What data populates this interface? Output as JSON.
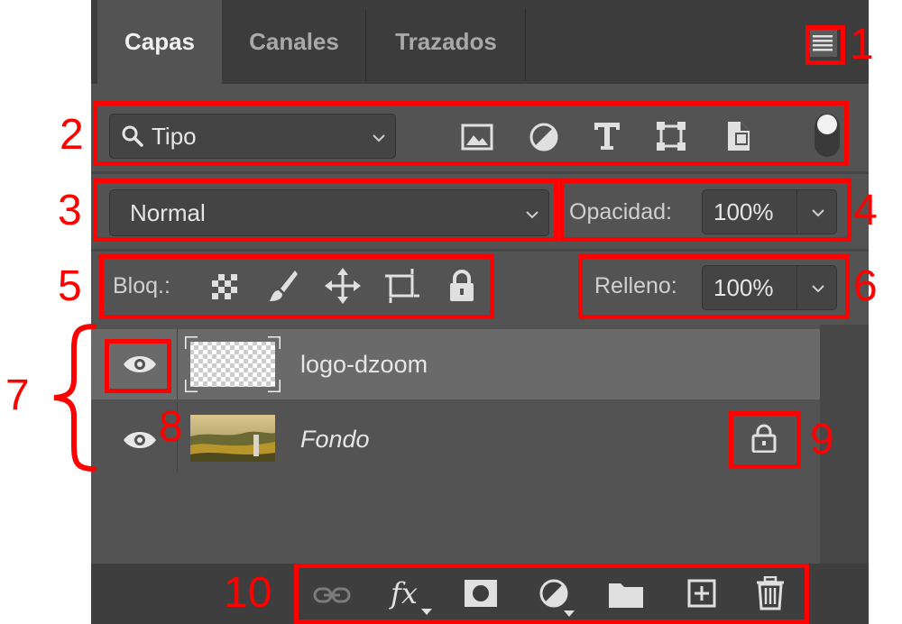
{
  "panel": {
    "tabs": [
      {
        "label": "Capas",
        "active": true
      },
      {
        "label": "Canales",
        "active": false
      },
      {
        "label": "Trazados",
        "active": false
      }
    ],
    "menu_icon": "panel-menu-icon"
  },
  "filter": {
    "search_label": "Tipo",
    "icons": [
      "image-filter-icon",
      "adjustment-filter-icon",
      "type-filter-icon",
      "shape-filter-icon",
      "smart-object-filter-icon",
      "filter-toggle-icon"
    ]
  },
  "blend": {
    "mode": "Normal",
    "opacity_label": "Opacidad:",
    "opacity_value": "100%"
  },
  "lock": {
    "label": "Bloq.:",
    "icons": [
      "lock-transparency-icon",
      "lock-pixels-icon",
      "lock-position-icon",
      "lock-artboard-icon",
      "lock-all-icon"
    ],
    "fill_label": "Relleno:",
    "fill_value": "100%"
  },
  "layers": [
    {
      "name": "logo-dzoom",
      "visible": true,
      "selected": true,
      "italic": false,
      "locked": false
    },
    {
      "name": "Fondo",
      "visible": true,
      "selected": false,
      "italic": true,
      "locked": true
    }
  ],
  "footer": {
    "icons": [
      "link-layers-icon",
      "fx-icon",
      "layer-mask-icon",
      "adjustment-layer-icon",
      "group-folder-icon",
      "new-layer-icon",
      "delete-icon"
    ],
    "fx_label": "fx"
  },
  "annotations": {
    "labels": [
      "1",
      "2",
      "3",
      "4",
      "5",
      "6",
      "7",
      "8",
      "9",
      "10"
    ],
    "color": "#ff0000"
  },
  "colors": {
    "panel_bg": "#535353",
    "tab_bar_bg": "#3c3c3c",
    "selected_layer_bg": "#6a6a6a",
    "annotation_red": "#ff0000"
  }
}
